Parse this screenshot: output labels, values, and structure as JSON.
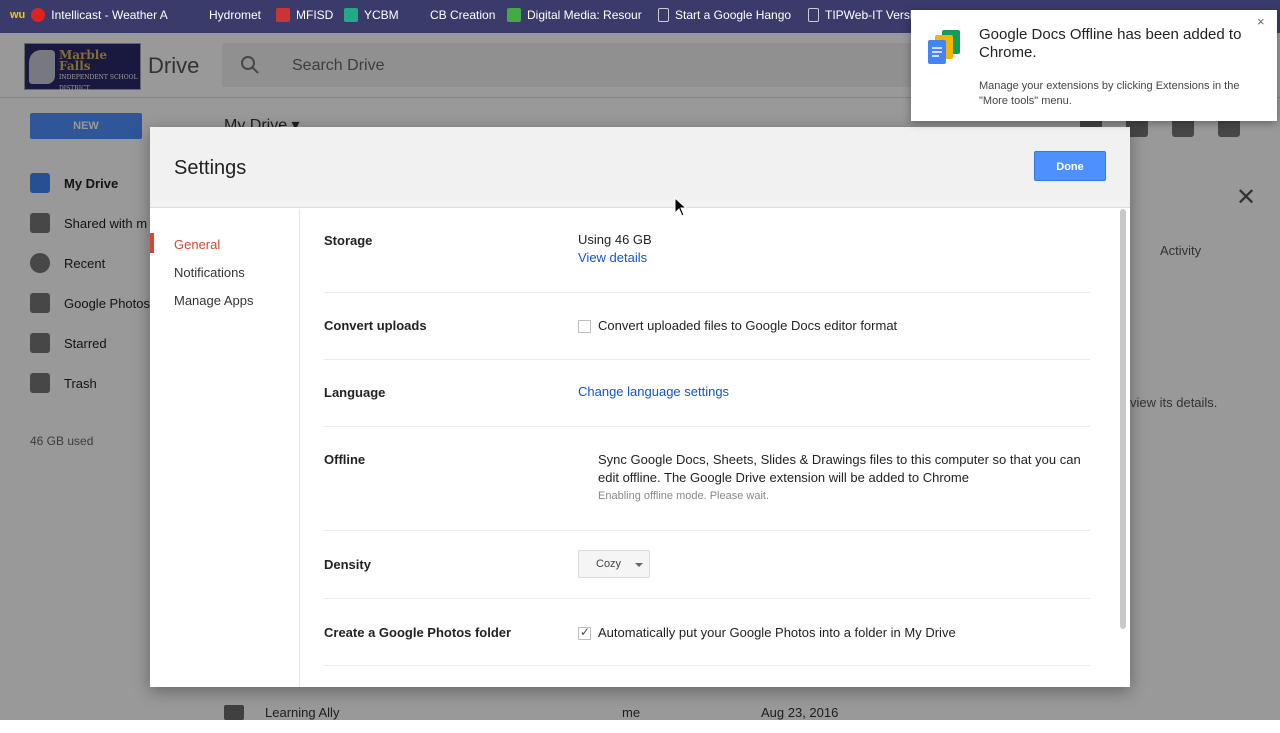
{
  "bookmarks": [
    {
      "label": "Intellicast - Weather A",
      "icon": "intellicast-icon",
      "color": "#d22"
    },
    {
      "label": "Hydromet",
      "icon": "hydromet-icon",
      "color": "#3b3b6b"
    },
    {
      "label": "MFISD",
      "icon": "mfisd-icon",
      "color": "#c33"
    },
    {
      "label": "YCBM",
      "icon": "ycbm-icon",
      "color": "#2a8"
    },
    {
      "label": "CB Creation",
      "icon": "cb-creation-icon",
      "color": "#3b3b6b"
    },
    {
      "label": "Digital Media: Resour",
      "icon": "digital-media-icon",
      "color": "#4a4"
    },
    {
      "label": "Start a Google Hango",
      "icon": "page-icon",
      "color": "#ddd"
    },
    {
      "label": "TIPWeb-IT Versi",
      "icon": "page-icon",
      "color": "#ddd"
    }
  ],
  "drive": {
    "logo_text": "Marble Falls",
    "logo_sub": "INDEPENDENT SCHOOL DISTRICT",
    "title": "Drive",
    "search_placeholder": "Search Drive",
    "new_label": "NEW",
    "heading": "My Drive",
    "nav": [
      {
        "label": "My Drive",
        "icon": "my-drive-icon"
      },
      {
        "label": "Shared with m",
        "icon": "shared-icon"
      },
      {
        "label": "Recent",
        "icon": "recent-icon"
      },
      {
        "label": "Google Photos",
        "icon": "photos-icon"
      },
      {
        "label": "Starred",
        "icon": "star-icon"
      },
      {
        "label": "Trash",
        "icon": "trash-icon"
      }
    ],
    "storage_used": "46 GB used",
    "details_tab": "Activity",
    "details_hint": "view its details.",
    "file_row": {
      "name": "Learning Ally",
      "owner": "me",
      "date": "Aug 23, 2016"
    }
  },
  "settings": {
    "title": "Settings",
    "done_label": "Done",
    "nav": [
      "General",
      "Notifications",
      "Manage Apps"
    ],
    "storage": {
      "label": "Storage",
      "value": "Using 46 GB",
      "link": "View details"
    },
    "convert": {
      "label": "Convert uploads",
      "text": "Convert uploaded files to Google Docs editor format",
      "checked": false
    },
    "language": {
      "label": "Language",
      "link": "Change language settings"
    },
    "offline": {
      "label": "Offline",
      "text": "Sync Google Docs, Sheets, Slides & Drawings files to this computer so that you can edit offline. The Google Drive extension will be added to Chrome",
      "sub": "Enabling offline mode. Please wait."
    },
    "density": {
      "label": "Density",
      "value": "Cozy"
    },
    "photos": {
      "label": "Create a Google Photos folder",
      "text": "Automatically put your Google Photos into a folder in My Drive",
      "checked": true
    }
  },
  "toast": {
    "title": "Google Docs Offline has been added to Chrome.",
    "message": "Manage your extensions by clicking Extensions in the \"More tools\" menu.",
    "close": "×"
  },
  "colors": {
    "accent": "#4d90fe",
    "active_nav": "#d14836",
    "link": "#15c"
  }
}
